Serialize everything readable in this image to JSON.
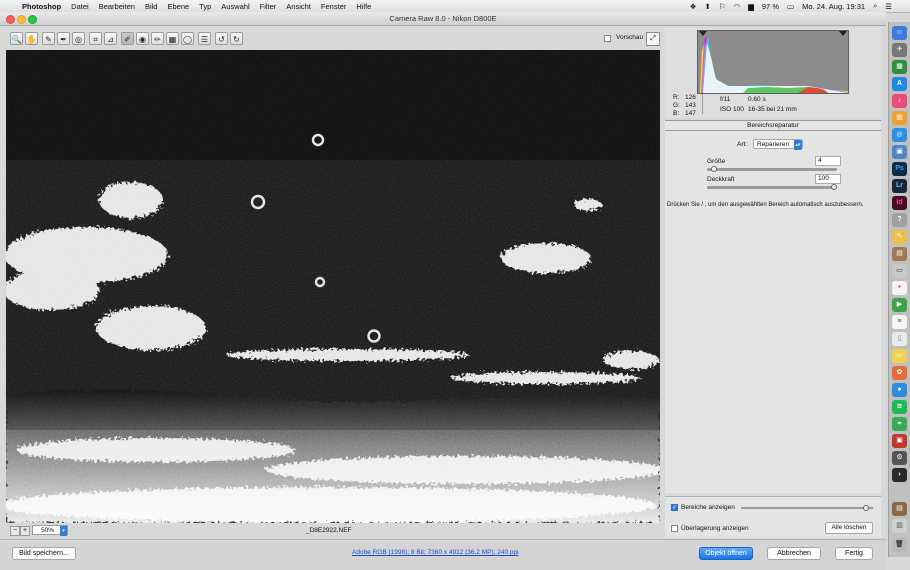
{
  "menubar": {
    "app": "Photoshop",
    "items": [
      "Datei",
      "Bearbeiten",
      "Bild",
      "Ebene",
      "Typ",
      "Auswahl",
      "Filter",
      "Ansicht",
      "Fenster",
      "Hilfe"
    ],
    "battery": "97 %",
    "clock": "Mo. 24. Aug.  19:31"
  },
  "window": {
    "title": "Camera Raw 8.0 - Nikon D800E"
  },
  "toolbar": {
    "preview_label": "Vorschau",
    "tools": [
      {
        "name": "zoom-tool-icon",
        "glyph": "🔍"
      },
      {
        "name": "hand-tool-icon",
        "glyph": "✋"
      },
      {
        "name": "white-balance-tool-icon",
        "glyph": "✎"
      },
      {
        "name": "color-sampler-tool-icon",
        "glyph": "✒"
      },
      {
        "name": "targeted-adjustment-tool-icon",
        "glyph": "◎"
      },
      {
        "name": "crop-tool-icon",
        "glyph": "⌗"
      },
      {
        "name": "straighten-tool-icon",
        "glyph": "⊿"
      },
      {
        "name": "spot-removal-tool-icon",
        "glyph": "✐"
      },
      {
        "name": "red-eye-tool-icon",
        "glyph": "◉"
      },
      {
        "name": "adjustment-brush-icon",
        "glyph": "✏"
      },
      {
        "name": "graduated-filter-icon",
        "glyph": "▦"
      },
      {
        "name": "radial-filter-icon",
        "glyph": "◯"
      },
      {
        "name": "preferences-icon",
        "glyph": "☰"
      },
      {
        "name": "rotate-left-icon",
        "glyph": "↺"
      },
      {
        "name": "rotate-right-icon",
        "glyph": "↻"
      }
    ]
  },
  "status": {
    "zoom": "50%",
    "minus": "−",
    "plus": "+",
    "filename": "_D8E2922.NEF"
  },
  "info": {
    "r_label": "R:",
    "r": "126",
    "g_label": "G:",
    "g": "143",
    "b_label": "B:",
    "b": "147",
    "aperture": "f/11",
    "shutter": "0.60 s",
    "iso": "ISO 100",
    "lens": "16-35 bei 21 mm"
  },
  "panel": {
    "title": "Bereichsreparatur",
    "art_label": "Art:",
    "art_value": "Reparieren",
    "size_label": "Größe",
    "size_value": "4",
    "opacity_label": "Deckkraft",
    "opacity_value": "100",
    "hint": "Drücken Sie / , um den ausgewählten Bereich automatisch auszubessern.",
    "show_spots_label": "Bereiche anzeigen",
    "show_overlay_label": "Überlagerung anzeigen",
    "clear_all_label": "Alle löschen"
  },
  "sliders": {
    "size_fraction": 0.03,
    "opacity_fraction": 1.0,
    "visualize_fraction": 0.97
  },
  "bottom": {
    "save_label": "Bild speichern...",
    "workflow_link": "Adobe RGB (1998); 8 Bit; 7360 x 4912 (36,2 MP); 240 ppi",
    "open_label": "Objekt öffnen",
    "cancel_label": "Abbrechen",
    "done_label": "Fertig"
  },
  "colors": {
    "accent": "#2f7ed8",
    "link": "#1a4fd0",
    "canvas": "#0b0b0b"
  }
}
